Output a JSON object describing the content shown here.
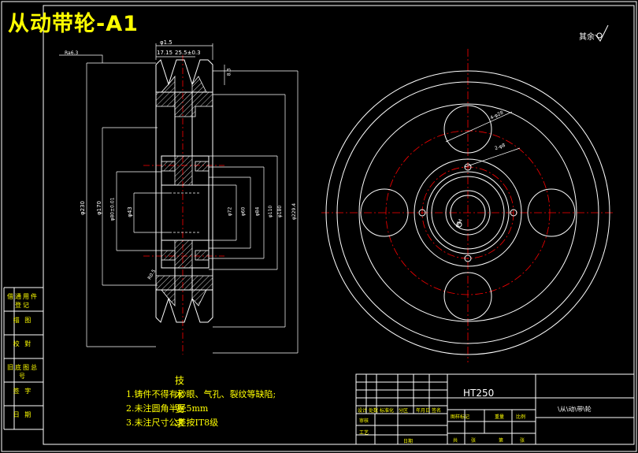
{
  "title": "从动带轮-A1",
  "roughness_text": "其余",
  "notes": {
    "heading": "技 术 要 求",
    "items": [
      "1.铸件不得有砂眼、气孔、裂纹等缺陷;",
      "2.未注圆角半径5mm",
      "3.未注尺寸公差按IT8级"
    ]
  },
  "side_labels": [
    "借通用件登记",
    "描 图",
    "校 對",
    "旧底图总号",
    "签 字",
    "日 期"
  ],
  "title_block": {
    "material": "HT250",
    "drawing_name": "\\从\\动\\带\\轮",
    "cells": [
      "设计",
      "标准化",
      "年月日",
      "签名",
      "审核",
      "工艺",
      "日期",
      "图样标记",
      "重量",
      "比例",
      "共",
      "张",
      "第",
      "张",
      "处数",
      "分区"
    ]
  },
  "dimensions": {
    "top": [
      "φ1.5",
      "17.15",
      "25.5±0.3"
    ],
    "left": [
      "φ230",
      "φ170",
      "φ80±0.01",
      "φ43"
    ],
    "right": [
      "φ72",
      "φ60",
      "φ84",
      "φ110",
      "φ180",
      "φ229.4"
    ],
    "misc": [
      "8.3",
      "R0.5",
      "Ra6.3"
    ],
    "front_view": [
      "4-φ28",
      "2-φ8",
      "φ44"
    ]
  },
  "colors": {
    "background": "#000000",
    "lines": "#ffffff",
    "centerlines": "#ff0000",
    "text": "#ffff00",
    "hatch": "#ffffff"
  }
}
